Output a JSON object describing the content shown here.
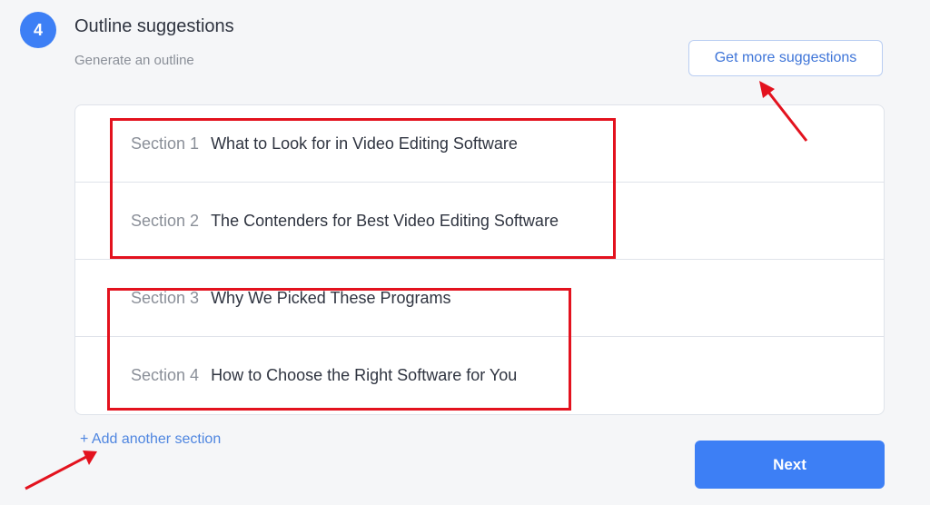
{
  "step": {
    "number": "4",
    "title": "Outline suggestions",
    "subtitle": "Generate an outline"
  },
  "get_more_label": "Get more suggestions",
  "sections": [
    {
      "label": "Section 1",
      "title": "What to Look for in Video Editing Software"
    },
    {
      "label": "Section 2",
      "title": "The Contenders for Best Video Editing Software"
    },
    {
      "label": "Section 3",
      "title": "Why We Picked These Programs"
    },
    {
      "label": "Section 4",
      "title": "How to Choose the Right Software for You"
    }
  ],
  "add_section_label": "+ Add another section",
  "next_label": "Next",
  "colors": {
    "accent": "#3d7ff5",
    "annotation": "#e3121e"
  }
}
